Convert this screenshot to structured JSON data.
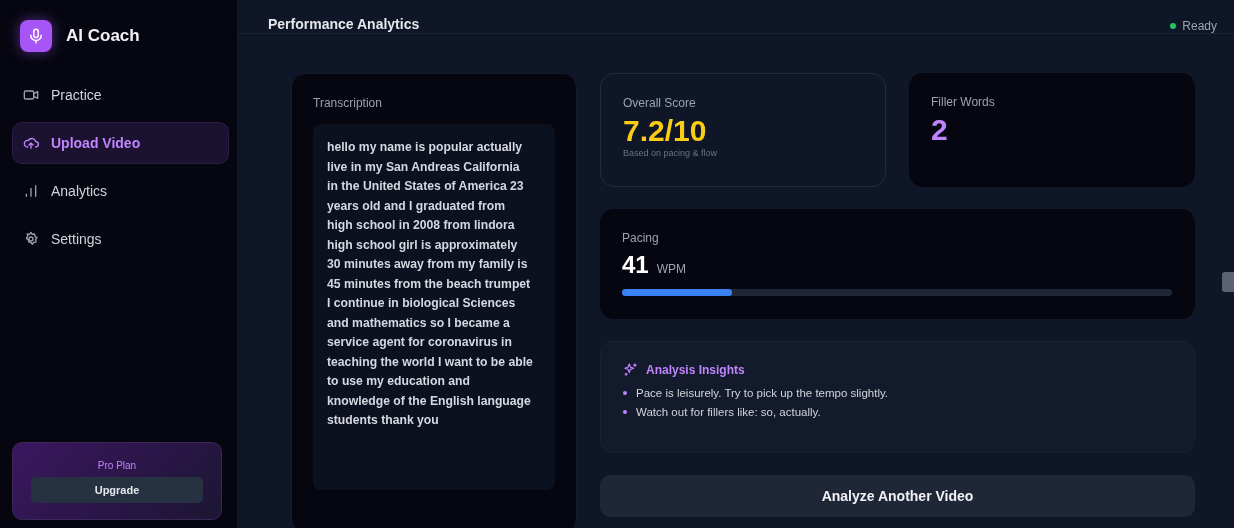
{
  "app": {
    "name": "AI Coach"
  },
  "nav": [
    {
      "label": "Practice",
      "selected": false
    },
    {
      "label": "Upload Video",
      "selected": true
    },
    {
      "label": "Analytics",
      "selected": false
    },
    {
      "label": "Settings",
      "selected": false
    }
  ],
  "plan": {
    "title": "Pro Plan",
    "button": "Upgrade"
  },
  "header": {
    "title": "Performance Analytics",
    "status": "Ready"
  },
  "transcription": {
    "title": "Transcription",
    "text": "hello my name is popular actually live in my San Andreas California in the United States of America 23 years old and I graduated from high school in 2008 from lindora high school girl is approximately 30 minutes away from my family is 45 minutes from the beach trumpet I continue in biological Sciences and mathematics so I became a service agent for coronavirus in teaching the world I want to be able to use my education and knowledge of the English language students thank you"
  },
  "score": {
    "label": "Overall Score",
    "value": "7.2/10",
    "note": "Based on pacing & flow"
  },
  "filler": {
    "label": "Filler Words",
    "value": "2"
  },
  "pacing": {
    "label": "Pacing",
    "value": "41",
    "unit": "WPM",
    "level": 0.2
  },
  "insights": {
    "title": "Analysis Insights",
    "items": [
      "Pace is leisurely. Try to pick up the tempo slightly.",
      "Watch out for fillers like: so, actually."
    ]
  },
  "action": {
    "label": "Analyze Another Video"
  }
}
